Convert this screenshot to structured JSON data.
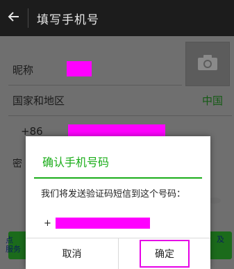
{
  "appbar": {
    "title": "填写手机号",
    "back_icon": "arrow-left-icon"
  },
  "form": {
    "nickname_label": "昵称",
    "region_label": "国家和地区",
    "region_value": "中国",
    "country_code": "+86",
    "password_label_partial": "密",
    "bottom_left_1": "点",
    "bottom_left_2": "服务",
    "bottom_right": "及",
    "colors": {
      "brand_green": "#1aad19",
      "redaction": "#ff00ff"
    }
  },
  "dialog": {
    "title": "确认手机号码",
    "message": "我们将发送验证码短信到这个号码：",
    "phone_prefix": "+",
    "cancel_label": "取消",
    "confirm_label": "确定"
  }
}
